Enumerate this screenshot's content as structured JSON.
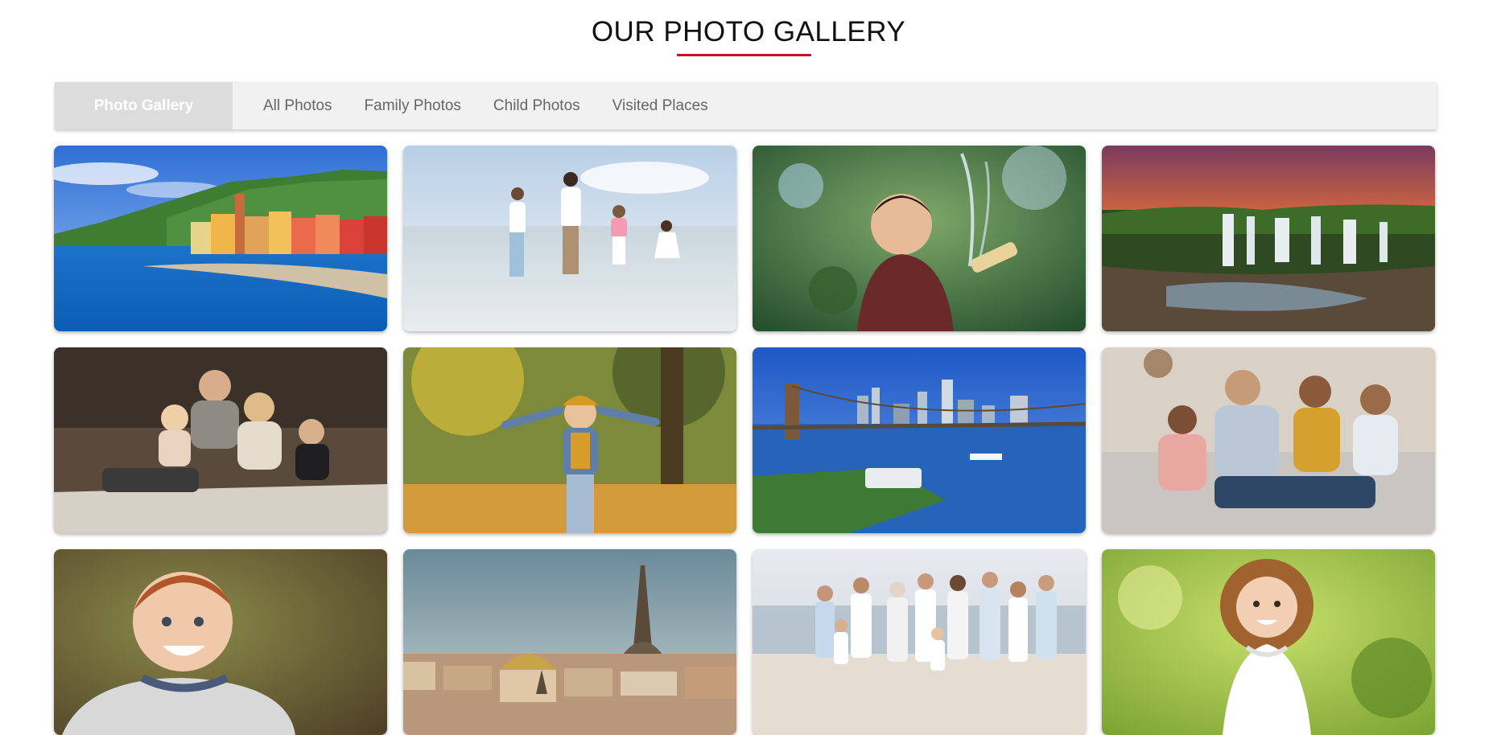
{
  "header": {
    "title": "OUR PHOTO GALLERY",
    "accent_color": "#c8102e"
  },
  "nav": {
    "brand": "Photo Gallery",
    "links": [
      "All Photos",
      "Family Photos",
      "Child Photos",
      "Visited Places"
    ]
  },
  "gallery": {
    "photos": [
      {
        "subject": "colorful-coastal-town",
        "category": "Visited Places"
      },
      {
        "subject": "family-walking-on-beach",
        "category": "Family Photos"
      },
      {
        "subject": "child-playing-with-water-hose",
        "category": "Child Photos"
      },
      {
        "subject": "waterfalls-at-sunset",
        "category": "Visited Places"
      },
      {
        "subject": "family-sitting-outdoors",
        "category": "Family Photos"
      },
      {
        "subject": "child-in-autumn-park",
        "category": "Child Photos"
      },
      {
        "subject": "brooklyn-bridge-skyline",
        "category": "Visited Places"
      },
      {
        "subject": "family-on-sofa",
        "category": "Family Photos"
      },
      {
        "subject": "smiling-boy-portrait",
        "category": "Child Photos"
      },
      {
        "subject": "paris-eiffel-tower",
        "category": "Visited Places"
      },
      {
        "subject": "large-family-on-beach",
        "category": "Family Photos"
      },
      {
        "subject": "curly-haired-girl",
        "category": "Child Photos"
      }
    ]
  }
}
